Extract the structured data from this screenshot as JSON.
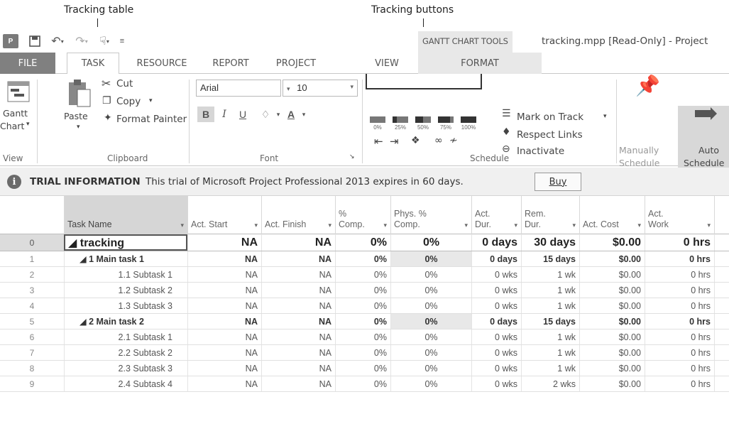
{
  "callouts": {
    "tracking_table": "Tracking table",
    "tracking_buttons": "Tracking buttons"
  },
  "titlebar": {
    "app_icon": "P",
    "context_group": "GANTT CHART TOOLS",
    "doc_title": "tracking.mpp [Read-Only] - Project"
  },
  "tabs": {
    "file": "FILE",
    "task": "TASK",
    "resource": "RESOURCE",
    "report": "REPORT",
    "project": "PROJECT",
    "view": "VIEW",
    "format": "FORMAT"
  },
  "ribbon": {
    "view_group": {
      "gantt_label_1": "Gantt",
      "gantt_label_2": "Chart",
      "label": "View"
    },
    "clipboard": {
      "paste": "Paste",
      "cut": "Cut",
      "copy": "Copy",
      "format_painter": "Format Painter",
      "label": "Clipboard"
    },
    "font": {
      "family": "Arial",
      "size": "10",
      "bold": "B",
      "italic": "I",
      "underline": "U",
      "label": "Font"
    },
    "schedule": {
      "pct_buttons": [
        "0%",
        "25%",
        "50%",
        "75%",
        "100%"
      ],
      "pct_fill": [
        0,
        0.25,
        0.5,
        0.75,
        1.0
      ],
      "mark_on_track": "Mark on Track",
      "respect_links": "Respect Links",
      "inactivate": "Inactivate",
      "label": "Schedule"
    },
    "tasks": {
      "manually_1": "Manually",
      "manually_2": "Schedule",
      "auto_1": "Auto",
      "auto_2": "Schedule"
    }
  },
  "trial": {
    "icon": "i",
    "heading": "TRIAL INFORMATION",
    "message": "This trial of Microsoft Project Professional 2013 expires in 60 days.",
    "buy": "Buy"
  },
  "table": {
    "headers": {
      "task_name": "Task Name",
      "act_start": "Act. Start",
      "act_finish": "Act. Finish",
      "pct_comp_1": "%",
      "pct_comp_2": "Comp.",
      "phys_1": "Phys. %",
      "phys_2": "Comp.",
      "act_dur_1": "Act.",
      "act_dur_2": "Dur.",
      "rem_dur_1": "Rem.",
      "rem_dur_2": "Dur.",
      "act_cost": "Act. Cost",
      "act_work_1": "Act.",
      "act_work_2": "Work"
    },
    "rows": [
      {
        "id": "0",
        "name": "◢ tracking",
        "start": "NA",
        "finish": "NA",
        "pct": "0%",
        "phys": "0%",
        "act_dur": "0 days",
        "rem_dur": "30 days",
        "cost": "$0.00",
        "work": "0 hrs"
      },
      {
        "id": "1",
        "name": "◢ 1 Main task 1",
        "start": "NA",
        "finish": "NA",
        "pct": "0%",
        "phys": "0%",
        "act_dur": "0 days",
        "rem_dur": "15 days",
        "cost": "$0.00",
        "work": "0 hrs"
      },
      {
        "id": "2",
        "name": "1.1 Subtask 1",
        "start": "NA",
        "finish": "NA",
        "pct": "0%",
        "phys": "0%",
        "act_dur": "0 wks",
        "rem_dur": "1 wk",
        "cost": "$0.00",
        "work": "0 hrs"
      },
      {
        "id": "3",
        "name": "1.2 Subtask 2",
        "start": "NA",
        "finish": "NA",
        "pct": "0%",
        "phys": "0%",
        "act_dur": "0 wks",
        "rem_dur": "1 wk",
        "cost": "$0.00",
        "work": "0 hrs"
      },
      {
        "id": "4",
        "name": "1.3 Subtask 3",
        "start": "NA",
        "finish": "NA",
        "pct": "0%",
        "phys": "0%",
        "act_dur": "0 wks",
        "rem_dur": "1 wk",
        "cost": "$0.00",
        "work": "0 hrs"
      },
      {
        "id": "5",
        "name": "◢ 2 Main task 2",
        "start": "NA",
        "finish": "NA",
        "pct": "0%",
        "phys": "0%",
        "act_dur": "0 days",
        "rem_dur": "15 days",
        "cost": "$0.00",
        "work": "0 hrs"
      },
      {
        "id": "6",
        "name": "2.1 Subtask 1",
        "start": "NA",
        "finish": "NA",
        "pct": "0%",
        "phys": "0%",
        "act_dur": "0 wks",
        "rem_dur": "1 wk",
        "cost": "$0.00",
        "work": "0 hrs"
      },
      {
        "id": "7",
        "name": "2.2 Subtask 2",
        "start": "NA",
        "finish": "NA",
        "pct": "0%",
        "phys": "0%",
        "act_dur": "0 wks",
        "rem_dur": "1 wk",
        "cost": "$0.00",
        "work": "0 hrs"
      },
      {
        "id": "8",
        "name": "2.3 Subtask 3",
        "start": "NA",
        "finish": "NA",
        "pct": "0%",
        "phys": "0%",
        "act_dur": "0 wks",
        "rem_dur": "1 wk",
        "cost": "$0.00",
        "work": "0 hrs"
      },
      {
        "id": "9",
        "name": "2.4 Subtask 4",
        "start": "NA",
        "finish": "NA",
        "pct": "0%",
        "phys": "0%",
        "act_dur": "0 wks",
        "rem_dur": "2 wks",
        "cost": "$0.00",
        "work": "0 hrs"
      }
    ]
  },
  "colors": {
    "file_tab": "#808080",
    "selected_header": "#d6d6d6",
    "auto_schedule": "#d8d8d8"
  }
}
